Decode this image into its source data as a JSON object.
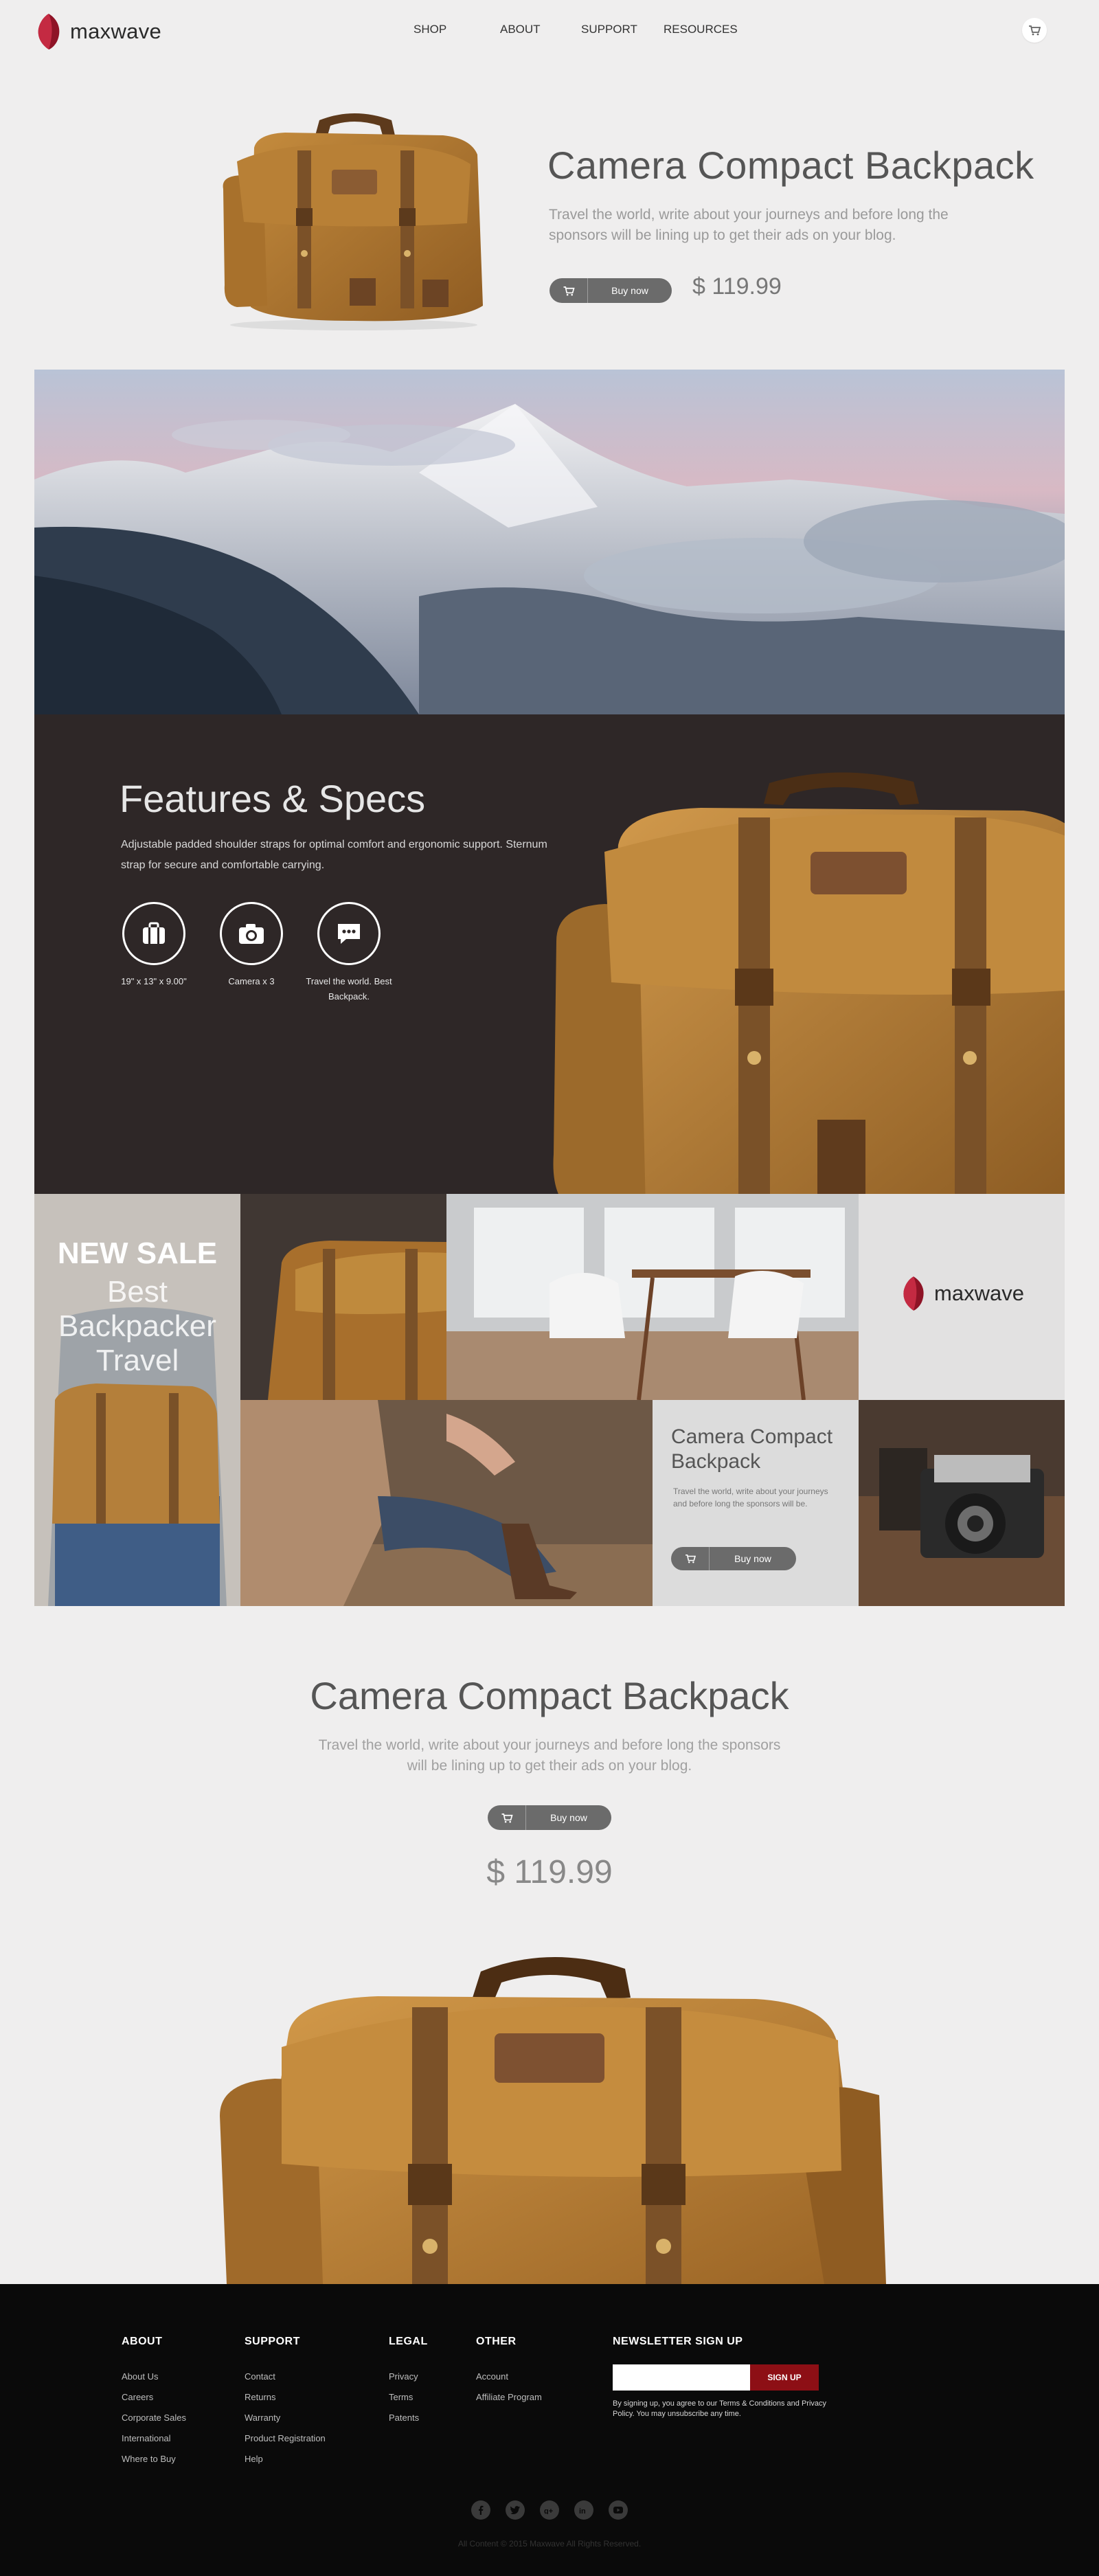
{
  "brand": {
    "name": "maxwave",
    "accent": "#a1192b"
  },
  "nav": {
    "items": [
      "SHOP",
      "ABOUT",
      "SUPPORT",
      "RESOURCES"
    ]
  },
  "hero": {
    "title": "Camera Compact Backpack",
    "description": "Travel the world, write about your journeys and before long the sponsors will be lining up to get their ads on your blog.",
    "buy_label": "Buy now",
    "price": "$ 119.99"
  },
  "features": {
    "title": "Features & Specs",
    "description": "Adjustable padded shoulder straps for optimal comfort and ergonomic support. Sternum strap for secure and comfortable carrying.",
    "items": [
      {
        "icon": "suitcase-icon",
        "label": "19\" x 13\" x 9.00\""
      },
      {
        "icon": "camera-icon",
        "label": "Camera x 3"
      },
      {
        "icon": "chat-icon",
        "label": "Travel the world. Best Backpack."
      }
    ]
  },
  "mosaic": {
    "sale_title": "NEW SALE",
    "sale_subtitle": "Best Backpacker Travel",
    "card_title": "Camera Compact Backpack",
    "card_desc": "Travel the world, write about your journeys and before long the sponsors will be.",
    "card_buy": "Buy now"
  },
  "product2": {
    "title": "Camera Compact Backpack",
    "description": "Travel the world, write about your journeys and before long the sponsors will be lining up to get their ads on your blog.",
    "buy_label": "Buy now",
    "price": "$ 119.99"
  },
  "footer": {
    "columns": [
      {
        "title": "ABOUT",
        "links": [
          "About Us",
          "Careers",
          "Corporate Sales",
          "International",
          "Where to Buy"
        ]
      },
      {
        "title": "SUPPORT",
        "links": [
          "Contact",
          "Returns",
          "Warranty",
          "Product Registration",
          "Help"
        ]
      },
      {
        "title": "LEGAL",
        "links": [
          "Privacy",
          "Terms",
          "Patents"
        ]
      },
      {
        "title": "OTHER",
        "links": [
          "Account",
          "Affiliate Program"
        ]
      }
    ],
    "newsletter": {
      "title": "NEWSLETTER SIGN UP",
      "button": "SIGN UP",
      "note": "By signing up, you agree to our Terms & Conditions and Privacy Policy. You may unsubscribe any time."
    },
    "social": [
      "facebook-icon",
      "twitter-icon",
      "google-plus-icon",
      "linkedin-icon",
      "youtube-icon"
    ],
    "copyright": "All Content © 2015 Maxwave All Rights Reserved."
  }
}
